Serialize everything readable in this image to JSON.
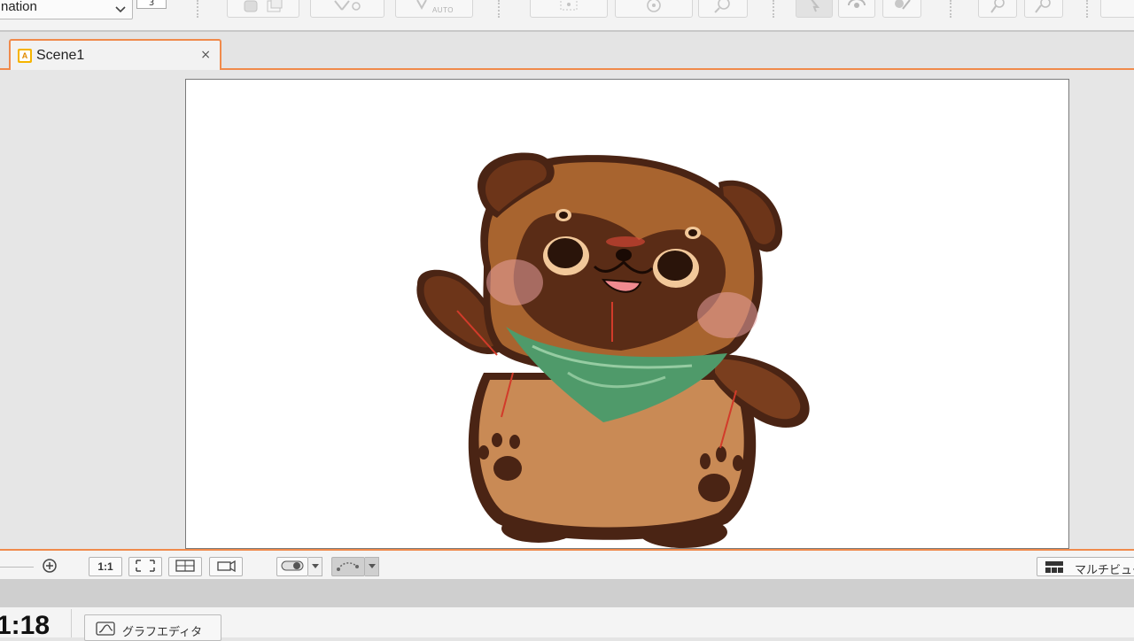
{
  "toolbar": {
    "mode_label": "nation",
    "frame_value": "3",
    "auto_label": "AUTO"
  },
  "scene_tab": {
    "icon_letter": "A",
    "label": "Scene1",
    "close_glyph": "×"
  },
  "viewbar": {
    "ratio_label": "1:1",
    "multiview_label": "マルチビュー"
  },
  "timeline": {
    "time": "1:18",
    "graph_editor_label": "グラフエディタ"
  },
  "colors": {
    "accent": "#f08a4b",
    "tab_icon": "#f5b400",
    "fur_dark": "#4a2414",
    "fur_mid": "#9a5a2e",
    "fur_light": "#c98a55",
    "bandana": "#4f9a6a"
  },
  "icons": [
    "chevron-down-icon",
    "bone-icon",
    "ik-icon",
    "auto-bone-icon",
    "mesh-icon",
    "rotate-icon",
    "magnify-icon",
    "select-arrow-icon",
    "rotate-tool-icon",
    "paint-icon",
    "pin-icon",
    "brush-icon",
    "zoom-in-icon",
    "fit-icon",
    "grid-icon",
    "camera-icon",
    "toggle-icon",
    "path-icon",
    "multiview-icon",
    "graph-icon",
    "close-icon"
  ]
}
